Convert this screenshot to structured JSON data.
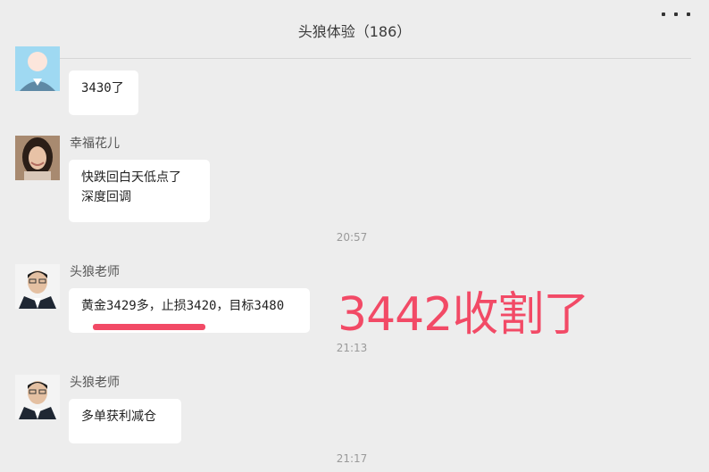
{
  "header": {
    "title": "头狼体验（186）",
    "more_icon": "more-dots-icon"
  },
  "messages": [
    {
      "sender": "",
      "avatar": "default-avatar-icon",
      "lines": [
        "3430了"
      ]
    },
    {
      "sender": "幸福花儿",
      "avatar": "woman-photo-avatar",
      "lines": [
        "快跌回白天低点了",
        "深度回调"
      ]
    },
    {
      "sender": "头狼老师",
      "avatar": "man-photo-avatar",
      "lines": [
        "黄金3429多，止损3420，目标3480"
      ]
    },
    {
      "sender": "头狼老师",
      "avatar": "man-photo-avatar",
      "lines": [
        "多单获利减仓"
      ]
    }
  ],
  "timestamps": [
    "20:57",
    "21:13",
    "21:17"
  ],
  "annotation": {
    "text": "3442收割了",
    "color": "#f24a66"
  },
  "colors": {
    "background": "#ededed",
    "bubble": "#ffffff",
    "highlight": "#f24a66"
  }
}
